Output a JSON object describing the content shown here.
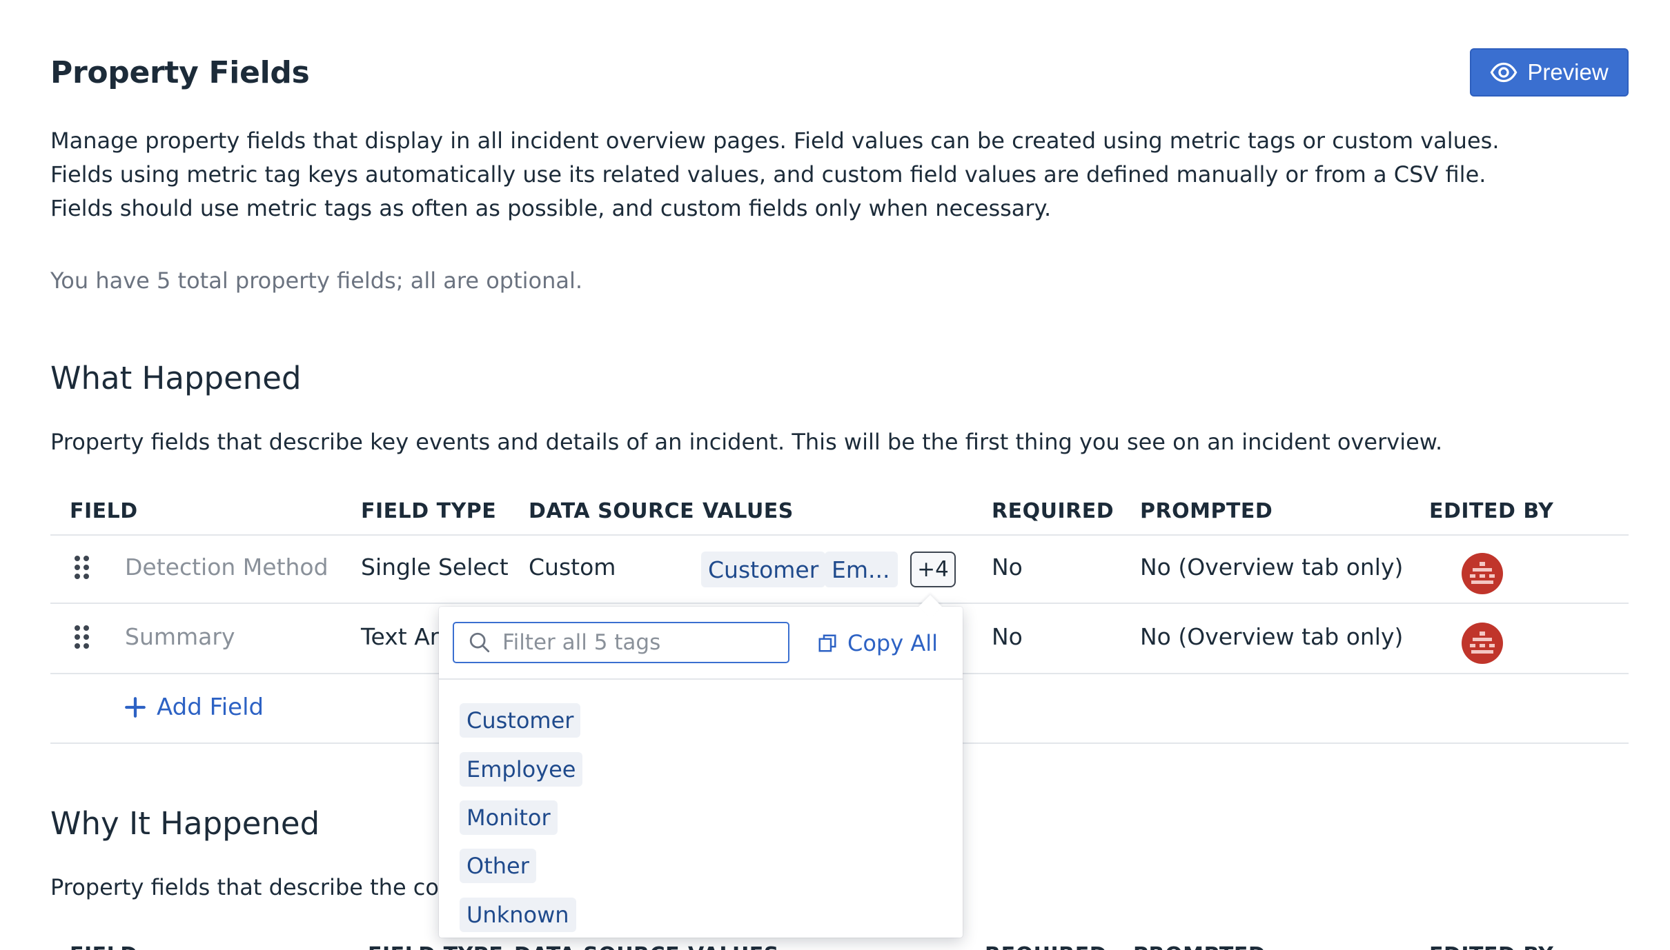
{
  "header": {
    "title": "Property Fields",
    "preview_label": "Preview"
  },
  "description": [
    "Manage property fields that display in all incident overview pages. Field values can be created using metric tags or custom values.",
    "Fields using metric tag keys automatically use its related values, and custom field values are defined manually or from a CSV file.",
    "Fields should use metric tags as often as possible, and custom fields only when necessary."
  ],
  "summary": "You have 5 total property fields; all are optional.",
  "sections": [
    {
      "title": "What Happened",
      "description": "Property fields that describe key events and details of an incident. This will be the first thing you see on an incident overview.",
      "columns": [
        "FIELD",
        "FIELD TYPE",
        "DATA SOURCE",
        "VALUES",
        "REQUIRED",
        "PROMPTED",
        "EDITED BY"
      ],
      "rows": [
        {
          "field": "Detection Method",
          "field_type": "Single Select",
          "data_source": "Custom",
          "values": [
            "Customer",
            "Em..."
          ],
          "more": "+4",
          "required": "No",
          "prompted": "No (Overview tab only)"
        },
        {
          "field": "Summary",
          "field_type": "Text Area",
          "data_source": "",
          "values": [],
          "more": "",
          "required": "No",
          "prompted": "No (Overview tab only)"
        }
      ],
      "add_field_label": "Add Field"
    },
    {
      "title": "Why It Happened",
      "description": "Property fields that describe the core",
      "columns": [
        "FIELD",
        "FIELD TYPE",
        "DATA SOURCE",
        "VALUES",
        "REQUIRED",
        "PROMPTED",
        "EDITED BY"
      ]
    }
  ],
  "popover": {
    "filter_placeholder": "Filter all 5 tags",
    "copy_all_label": "Copy All",
    "tags": [
      "Customer",
      "Employee",
      "Monitor",
      "Other",
      "Unknown"
    ]
  },
  "colors": {
    "accent": "#3a6fd0",
    "link": "#2d62c4",
    "tag_bg": "#eef1f6",
    "tag_text": "#1f4a8c",
    "avatar": "#c0352b"
  },
  "icons": [
    "eye-icon",
    "drag-handle-icon",
    "avatar-icon",
    "plus-icon",
    "search-icon",
    "copy-icon"
  ]
}
